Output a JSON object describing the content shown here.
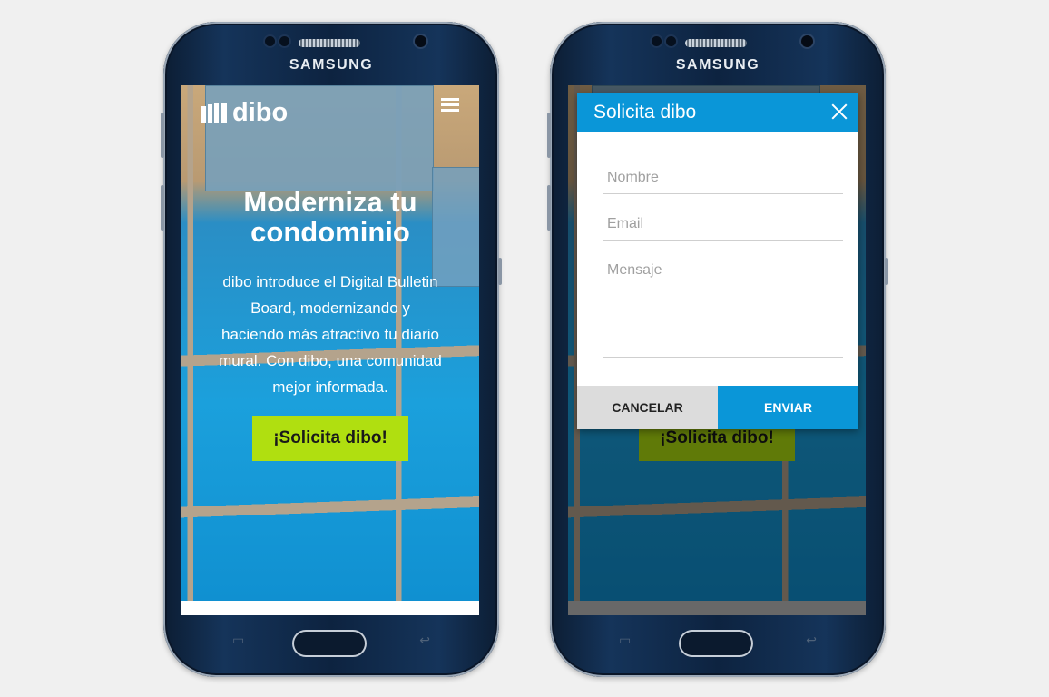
{
  "device": {
    "brand": "SAMSUNG"
  },
  "landing": {
    "logo_text": "dibo",
    "hero_title_line1": "Moderniza tu",
    "hero_title_line2": "condominio",
    "hero_body": "dibo introduce el Digital Bulletin Board, modernizando y haciendo más atractivo tu diario mural. Con dibo, una comunidad mejor informada.",
    "cta_label": "¡Solicita dibo!"
  },
  "modal": {
    "title": "Solicita dibo",
    "name_placeholder": "Nombre",
    "email_placeholder": "Email",
    "message_placeholder": "Mensaje",
    "cancel_label": "CANCELAR",
    "send_label": "ENVIAR"
  },
  "colors": {
    "accent_blue": "#0a96d8",
    "cta_green": "#b0df10"
  }
}
